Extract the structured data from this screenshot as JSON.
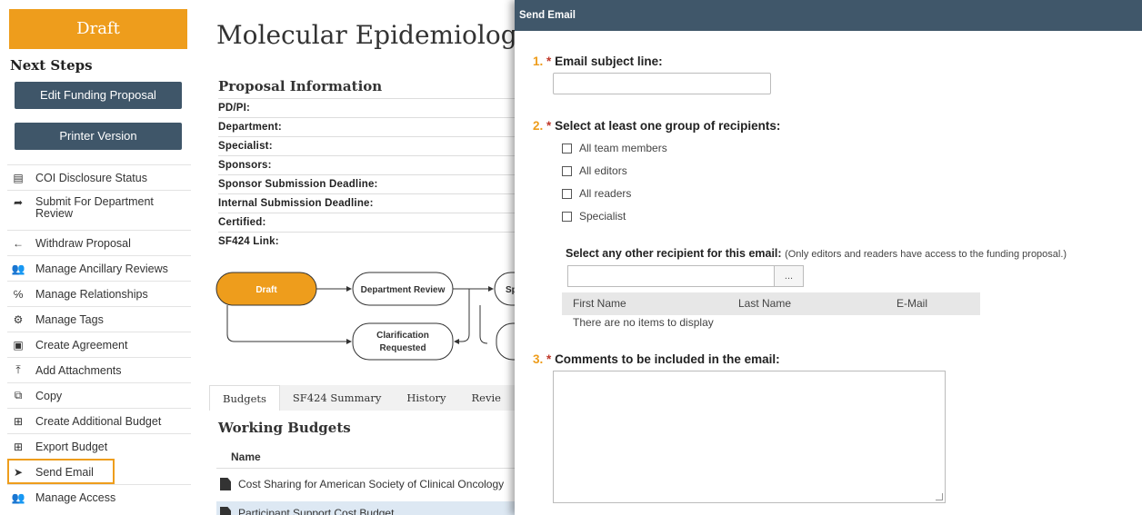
{
  "sidebar": {
    "state": "Draft",
    "next_steps": "Next Steps",
    "edit_button": "Edit Funding Proposal",
    "printer_button": "Printer Version",
    "items": [
      {
        "label": "COI Disclosure Status",
        "icon": "list-icon",
        "glyph": "▤"
      },
      {
        "label": "Submit For Department Review",
        "icon": "share-arrow-icon",
        "glyph": "➦"
      },
      {
        "label": "Withdraw Proposal",
        "icon": "arrow-left-icon",
        "glyph": "←"
      },
      {
        "label": "Manage Ancillary Reviews",
        "icon": "people-icon",
        "glyph": "👥"
      },
      {
        "label": "Manage Relationships",
        "icon": "relationships-icon",
        "glyph": "℅"
      },
      {
        "label": "Manage Tags",
        "icon": "gear-icon",
        "glyph": "⚙"
      },
      {
        "label": "Create Agreement",
        "icon": "agreement-icon",
        "glyph": "▣"
      },
      {
        "label": "Add Attachments",
        "icon": "upload-icon",
        "glyph": "⤒"
      },
      {
        "label": "Copy",
        "icon": "copy-icon",
        "glyph": "⧉"
      },
      {
        "label": "Create Additional Budget",
        "icon": "add-budget-icon",
        "glyph": "⊞"
      },
      {
        "label": "Export Budget",
        "icon": "export-icon",
        "glyph": "⊞"
      },
      {
        "label": "Send Email",
        "icon": "paper-plane-icon",
        "glyph": "➤"
      },
      {
        "label": "Manage Access",
        "icon": "users-icon",
        "glyph": "👥"
      }
    ]
  },
  "main": {
    "title": "Molecular Epidemiolog",
    "proposal_info_heading": "Proposal Information",
    "fields": [
      "PD/PI:",
      "Department:",
      "Specialist:",
      "Sponsors:",
      "Sponsor Submission Deadline:",
      "Internal Submission Deadline:",
      "Certified:",
      "SF424 Link:"
    ],
    "workflow": {
      "draft": "Draft",
      "department_review": "Department Review",
      "clarification_line1": "Clarification",
      "clarification_line2": "Requested",
      "next_partial": "Sp"
    },
    "tabs": [
      "Budgets",
      "SF424 Summary",
      "History",
      "Revie"
    ],
    "working_budgets_heading": "Working Budgets",
    "budget_name_col": "Name",
    "budgets": [
      "Cost Sharing for American Society of Clinical Oncology",
      "Participant Support Cost Budget"
    ]
  },
  "modal": {
    "title": "Send Email",
    "q1_num": "1.",
    "q1_label": "Email subject line:",
    "q2_num": "2.",
    "q2_label": "Select at least one group of recipients:",
    "groups": [
      "All team members",
      "All editors",
      "All readers",
      "Specialist"
    ],
    "other_label": "Select any other recipient for this email:",
    "other_note": "(Only editors and readers have access to the funding proposal.)",
    "picker_button": "...",
    "grid_columns": [
      "First Name",
      "Last Name",
      "E-Mail"
    ],
    "grid_empty": "There are no items to display",
    "q3_num": "3.",
    "q3_label": "Comments to be included in the email:",
    "required_mark": "*"
  },
  "colors": {
    "accent": "#ee9d1c",
    "dark_button": "#3f5669",
    "header": "#40576a",
    "required": "#c0392b"
  }
}
